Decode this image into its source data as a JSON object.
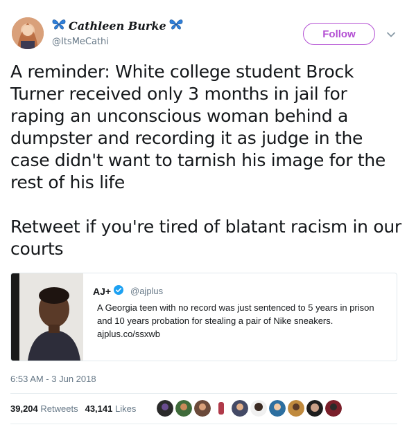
{
  "author": {
    "display_name": "Cathleen Burke",
    "handle": "@ItsMeCathi",
    "name_icons": [
      "butterfly-icon",
      "butterfly-icon"
    ]
  },
  "follow_label": "Follow",
  "tweet": {
    "text": "A reminder: White college student Brock Turner received only 3 months in jail for raping an unconscious woman behind a dumpster and recording it as judge in the case didn't want to tarnish his image for the rest of his life\n\nRetweet if you're tired of blatant racism in our courts"
  },
  "quoted_tweet": {
    "name": "AJ+",
    "handle": "@ajplus",
    "text": "A Georgia teen with no record was just sentenced to 5 years in prison and 10 years probation for stealing a pair of Nike sneakers.",
    "link": "ajplus.co/ssxwb"
  },
  "timestamp": "6:53 AM - 3 Jun 2018",
  "stats": {
    "retweets_count": "39,204",
    "retweets_label": "Retweets",
    "likes_count": "43,141",
    "likes_label": "Likes"
  },
  "colors": {
    "accent": "#b34fd3",
    "verified": "#1da1f2",
    "muted": "#657786"
  }
}
